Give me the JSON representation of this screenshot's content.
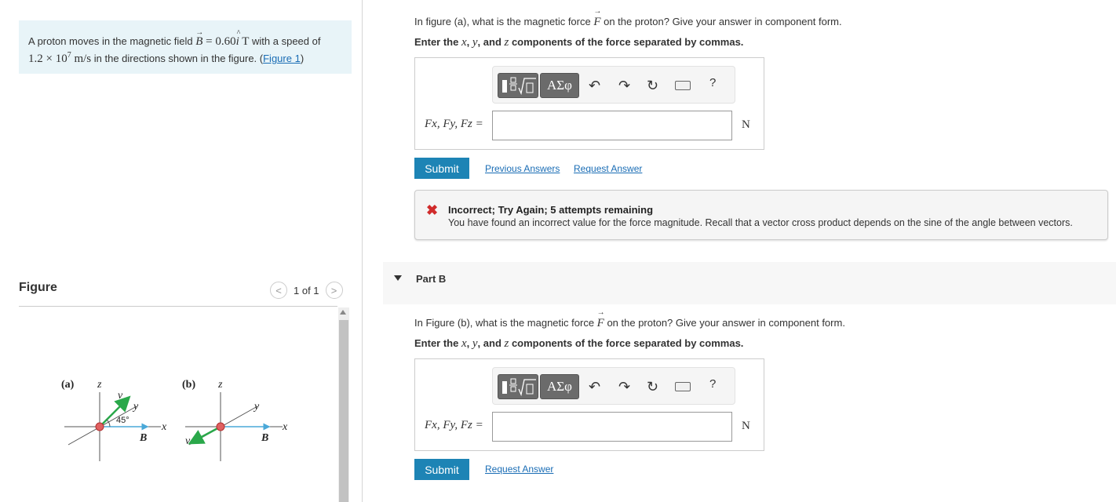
{
  "problem": {
    "text_1": "A proton moves in the magnetic field ",
    "b_symbol": "B",
    "b_value": " = 0.60",
    "i_symbol": "i",
    "unit": " T",
    "text_2": " with a speed of",
    "speed": "1.2 × 10",
    "speed_exp": "7",
    "speed_unit": " m/s",
    "text_3": " in the directions shown in the figure. (",
    "figure_link": "Figure 1",
    "text_4": ")"
  },
  "figure": {
    "title": "Figure",
    "pager_text": "1 of 1",
    "prev_glyph": "<",
    "next_glyph": ">",
    "labels": {
      "a": "(a)",
      "b": "(b)",
      "z": "z",
      "y": "y",
      "x": "x",
      "v": "v",
      "B": "B",
      "angle": "45°"
    }
  },
  "part_a": {
    "question_1": "In figure (a), what is the magnetic force ",
    "question_F": "F",
    "question_2": " on the proton? Give your answer in component form.",
    "instruction_1": "Enter the ",
    "instruction_x": "x",
    "instruction_2": ", ",
    "instruction_y": "y",
    "instruction_3": ", and ",
    "instruction_z": "z",
    "instruction_4": " components of the force separated by commas.",
    "symbol_button": "ΑΣφ",
    "help": "?",
    "answer_label": "Fx, Fy, Fz =",
    "unit": "N",
    "submit": "Submit",
    "previous_answers": "Previous Answers",
    "request_answer": "Request Answer",
    "feedback_icon": "✖",
    "feedback_title": "Incorrect; Try Again; 5 attempts remaining",
    "feedback_message": "You have found an incorrect value for the force magnitude. Recall that a vector cross product depends on the sine of the angle between vectors."
  },
  "part_b": {
    "title": "Part B",
    "question_1": "In Figure (b), what is the magnetic force ",
    "question_F": "F",
    "question_2": " on the proton? Give your answer in component form.",
    "instruction_1": "Enter the ",
    "instruction_x": "x",
    "instruction_2": ", ",
    "instruction_y": "y",
    "instruction_3": ", and ",
    "instruction_z": "z",
    "instruction_4": " components of the force separated by commas.",
    "symbol_button": "ΑΣφ",
    "help": "?",
    "answer_label": "Fx, Fy, Fz =",
    "unit": "N",
    "submit": "Submit",
    "request_answer": "Request Answer"
  },
  "colors": {
    "accent": "#1d84b5",
    "problem_bg": "#e8f4f8",
    "error": "#d02b2b",
    "velocity_arrow": "#2aa84a",
    "field_arrow": "#4aa8d8",
    "proton": "#e06060"
  }
}
